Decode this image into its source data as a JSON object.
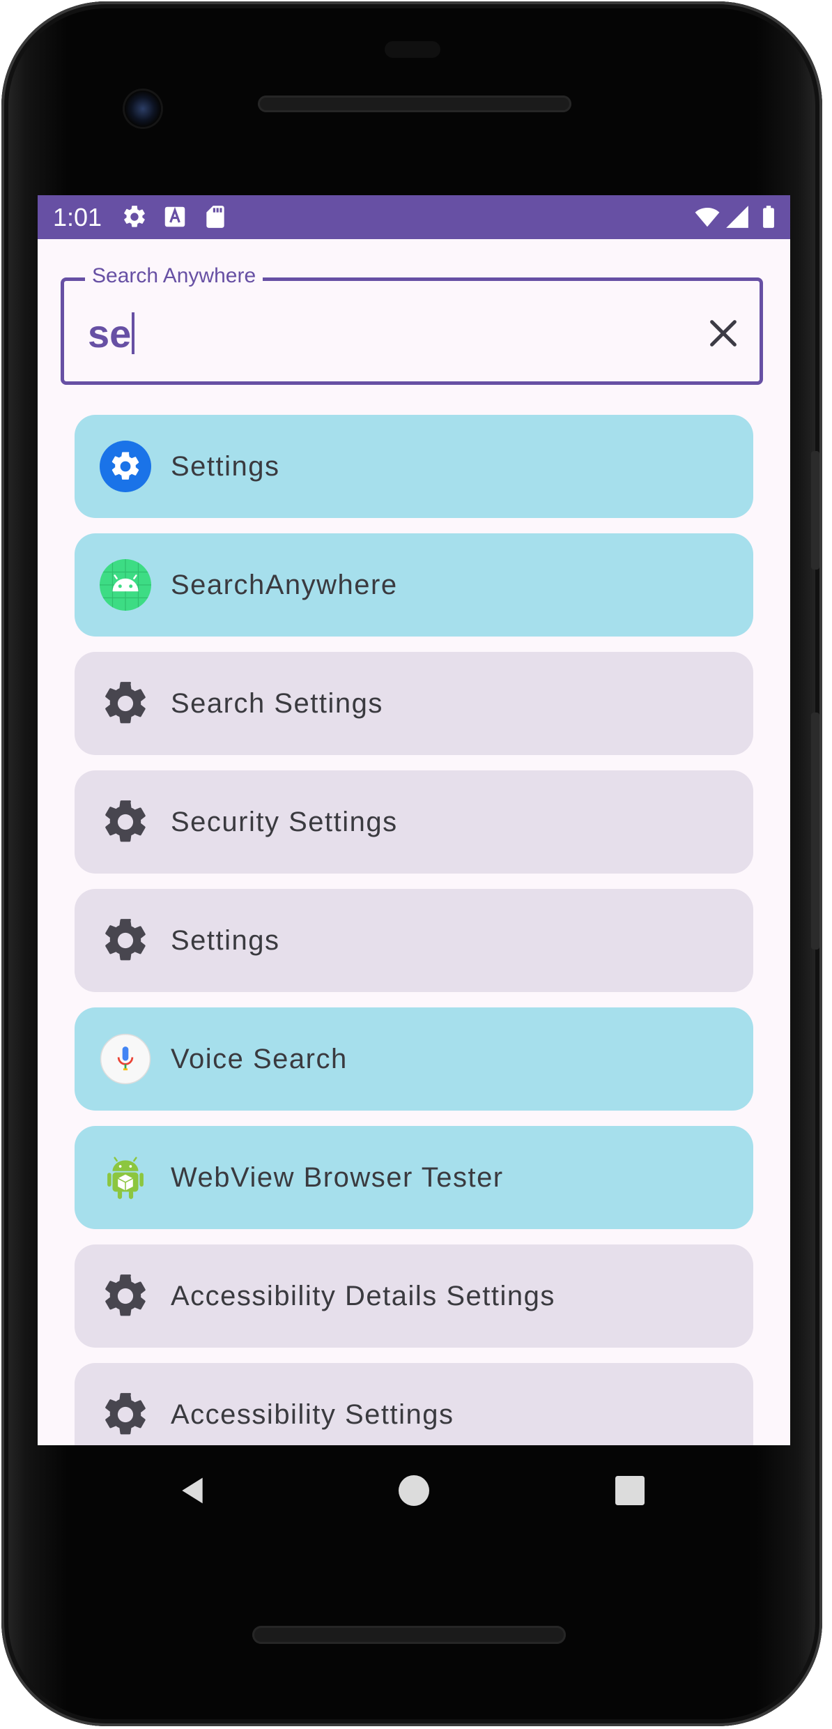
{
  "status_bar": {
    "time": "1:01",
    "icons": [
      "gear-icon",
      "text-a-icon",
      "sd-card-icon",
      "wifi-icon",
      "cell-signal-icon",
      "battery-icon"
    ],
    "background": "#6750a4"
  },
  "search": {
    "label": "Search Anywhere",
    "value": "se",
    "clear_icon": "close-icon",
    "accent": "#6750a4"
  },
  "results": [
    {
      "label": "Settings",
      "kind": "app",
      "icon": "settings-app-icon"
    },
    {
      "label": "SearchAnywhere",
      "kind": "app",
      "icon": "android-app-icon"
    },
    {
      "label": "Search Settings",
      "kind": "setting",
      "icon": "gear-icon"
    },
    {
      "label": "Security Settings",
      "kind": "setting",
      "icon": "gear-icon"
    },
    {
      "label": "Settings",
      "kind": "setting",
      "icon": "gear-icon"
    },
    {
      "label": "Voice Search",
      "kind": "app",
      "icon": "microphone-icon"
    },
    {
      "label": "WebView Browser Tester",
      "kind": "app",
      "icon": "android-robot-icon"
    },
    {
      "label": "Accessibility Details Settings",
      "kind": "setting",
      "icon": "gear-icon"
    },
    {
      "label": "Accessibility Settings",
      "kind": "setting",
      "icon": "gear-icon"
    }
  ],
  "colors": {
    "app_item": "#a6dfec",
    "setting_item": "#e6dfeb",
    "screen_background": "#fdf7fc"
  },
  "nav_bar": {
    "icons": [
      "back-icon",
      "home-icon",
      "recents-icon"
    ]
  }
}
